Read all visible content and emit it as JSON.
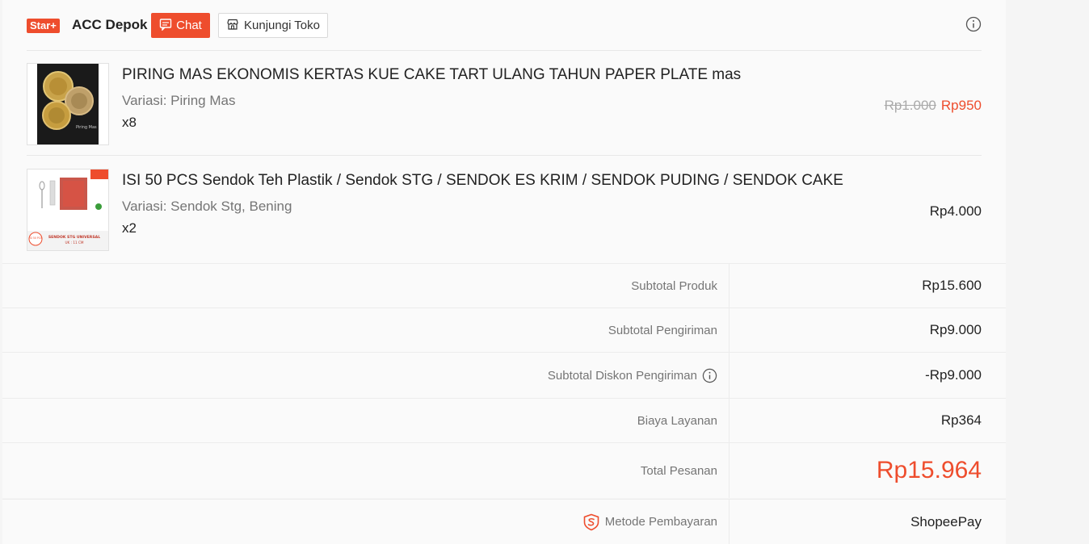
{
  "shop": {
    "badge": "Star+",
    "name": "ACC Depok",
    "chat_label": "Chat",
    "visit_label": "Kunjungi Toko"
  },
  "items": [
    {
      "title": "PIRING MAS EKONOMIS KERTAS KUE CAKE TART ULANG TAHUN PAPER PLATE mas",
      "variant": "Variasi: Piring Mas",
      "qty": "x8",
      "price_old": "Rp1.000",
      "price": "Rp950"
    },
    {
      "title": "ISI 50 PCS Sendok Teh Plastik / Sendok STG / SENDOK ES KRIM / SENDOK PUDING / SENDOK CAKE",
      "variant": "Variasi: Sendok Stg, Bening",
      "qty": "x2",
      "price": "Rp4.000",
      "thumb_caption_top": "ISI 50 PCS",
      "thumb_caption": "SENDOK STG UNIVERSAL",
      "thumb_caption_sub": "UK : 11 CM"
    }
  ],
  "summary": {
    "subtotal_produk_label": "Subtotal Produk",
    "subtotal_produk": "Rp15.600",
    "subtotal_pengiriman_label": "Subtotal Pengiriman",
    "subtotal_pengiriman": "Rp9.000",
    "diskon_label": "Subtotal Diskon Pengiriman",
    "diskon": "-Rp9.000",
    "biaya_label": "Biaya Layanan",
    "biaya": "Rp364",
    "total_label": "Total Pesanan",
    "total": "Rp15.964",
    "payment_label": "Metode Pembayaran",
    "payment": "ShopeePay"
  },
  "colors": {
    "accent": "#ee4d2d",
    "muted_text": "#757575"
  }
}
